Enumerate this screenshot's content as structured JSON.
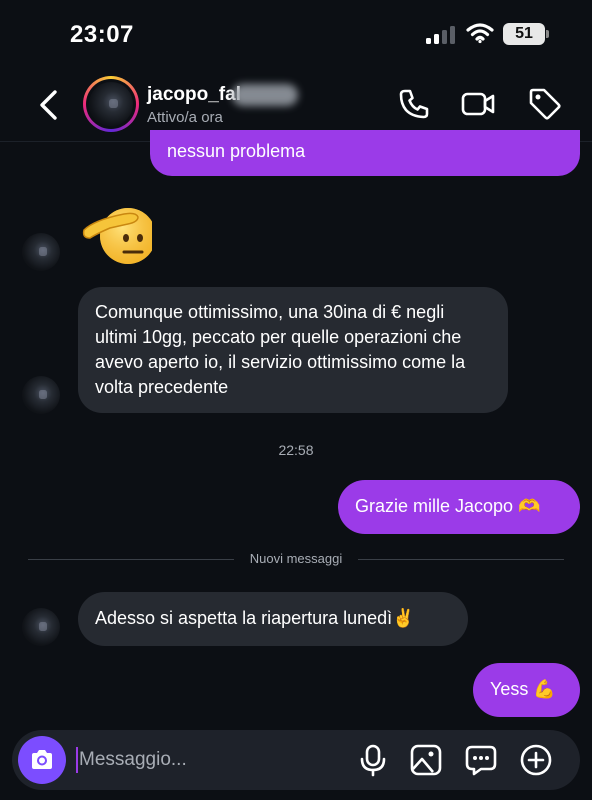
{
  "status_bar": {
    "time": "23:07",
    "battery_level": "51",
    "icons": [
      "signal-icon",
      "wifi-icon",
      "battery-icon"
    ]
  },
  "header": {
    "username": "jacopo_fal",
    "status": "Attivo/a ora",
    "actions": [
      "phone-icon",
      "video-icon",
      "tag-icon"
    ]
  },
  "messages": {
    "m1": {
      "text": "nessun problema",
      "from": "me"
    },
    "m2": {
      "emoji": "🫡",
      "from": "them"
    },
    "m3": {
      "text": "Comunque ottimissimo, una 30ina di € negli ultimi 10gg, peccato per quelle operazioni che avevo aperto io, il servizio ottimissimo come la volta precedente",
      "from": "them"
    },
    "timestamp": "22:58",
    "m4": {
      "text": "Grazie mille Jacopo 🫶",
      "from": "me"
    },
    "divider": "Nuovi messaggi",
    "m5": {
      "text": "Adesso si aspetta la riapertura lunedì✌️",
      "from": "them"
    },
    "m6": {
      "text": "Yess 💪",
      "from": "me"
    }
  },
  "composer": {
    "placeholder": "Messaggio...",
    "icons": [
      "camera-icon",
      "mic-icon",
      "gallery-icon",
      "sticker-icon",
      "plus-icon"
    ]
  },
  "colors": {
    "background": "#0c0f14",
    "outgoing_bubble": "#9b3be8",
    "incoming_bubble": "#262a31",
    "camera_button": "#7c4dff"
  }
}
